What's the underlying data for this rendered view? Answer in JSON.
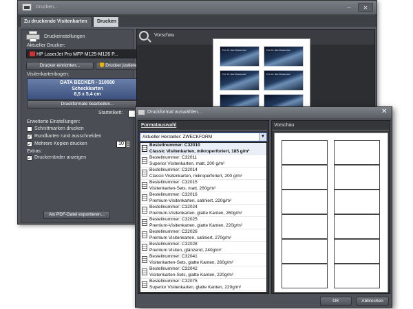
{
  "main_window": {
    "title": "Drucken...",
    "minimize_glyph": "–",
    "close_glyph": "✕",
    "tabs": [
      {
        "label": "Zu druckende Visitenkarten"
      },
      {
        "label": "Drucken"
      }
    ]
  },
  "left": {
    "print_settings": "Druckeinstellungen",
    "current_printer_label": "Aktueller Drucker:",
    "printer_value": "HP LaserJet Pro MFP M125-M126 P...",
    "printer_setup_button": "Drucker einrichten...",
    "printer_adjust_button": "Drucker justieren...",
    "card_sheet_label": "Visitenkartenbogen:",
    "card_sheet_line1": "DATA BECKER - 310560",
    "card_sheet_line2": "Scheckkarten",
    "card_sheet_line3": "8,5 x 5,4 cm",
    "edit_format_button": "Druckformate bearbeiten...",
    "start_label_text": "Startetikett:",
    "start_value": "1",
    "advanced_label": "Erweiterte Einstellungen:",
    "cut_marks": {
      "label": "Schnittmarken drucken",
      "checked": false
    },
    "round_cut": {
      "label": "Rundkarten rund ausschneiden",
      "checked": true
    },
    "multi_copies": {
      "label": "Mehrere Kopien drucken",
      "checked": true
    },
    "copies_value": "10",
    "extras_label": "Extras:",
    "printer_margins": {
      "label": "Druckerränder anzeigen",
      "checked": true
    },
    "export_pdf_button": "Als PDF-Datei exportieren..."
  },
  "preview": {
    "label": "Vorschau",
    "card_text": "Prof. Dr. Max Mustermann"
  },
  "dialog": {
    "title": "Druckformat auswählen...",
    "close_glyph": "✕",
    "format_heading": "Formatauswahl",
    "manufacturer_select": "Aktueller Hersteller: ZWECKFORM",
    "preview_label": "Vorschau",
    "formats": [
      {
        "number": "Bestellnummer: C32010",
        "desc": "Classic Visitenkarten, mikroperforiert, 185 g/m²",
        "selected": true
      },
      {
        "number": "Bestellnummer: C32011",
        "desc": "Superior Visitenkarten, matt, 200 g/m²",
        "selected": false
      },
      {
        "number": "Bestellnummer: C32014",
        "desc": "Classic Visitenkarten, mikroperforiert, 200 g/m²",
        "selected": false
      },
      {
        "number": "Bestellnummer: C32015",
        "desc": "Visitenkarten-Sets, matt, 260g/m²",
        "selected": false
      },
      {
        "number": "Bestellnummer: C32016",
        "desc": "Premium-Visitenkarten, satiniert, 220g/m²",
        "selected": false
      },
      {
        "number": "Bestellnummer: C32024",
        "desc": "Premium-Visitenkarten, glatte Kanten, 260g/m²",
        "selected": false
      },
      {
        "number": "Bestellnummer: C32025",
        "desc": "Premium-Visitenkarten, glatte Kanten, 220g/m²",
        "selected": false
      },
      {
        "number": "Bestellnummer: C32026",
        "desc": "Premium Visitenkarten, satiniert, 270g/m²",
        "selected": false
      },
      {
        "number": "Bestellnummer: C32028",
        "desc": "Premium Visiten, glänzend, 240g/m²",
        "selected": false
      },
      {
        "number": "Bestellnummer: C32041",
        "desc": "Visitenkarten-Sets, glatte Kanten, 260g/m²",
        "selected": false
      },
      {
        "number": "Bestellnummer: C32042",
        "desc": "Visitenkarten-Sets, glatte Kanten, 220g/m²",
        "selected": false
      },
      {
        "number": "Bestellnummer: C32075",
        "desc": "Superior Visitenkarten, glatte Kanten, 220g/m²",
        "selected": false
      }
    ],
    "ok_button": "OK",
    "cancel_button": "Abbrechen"
  }
}
